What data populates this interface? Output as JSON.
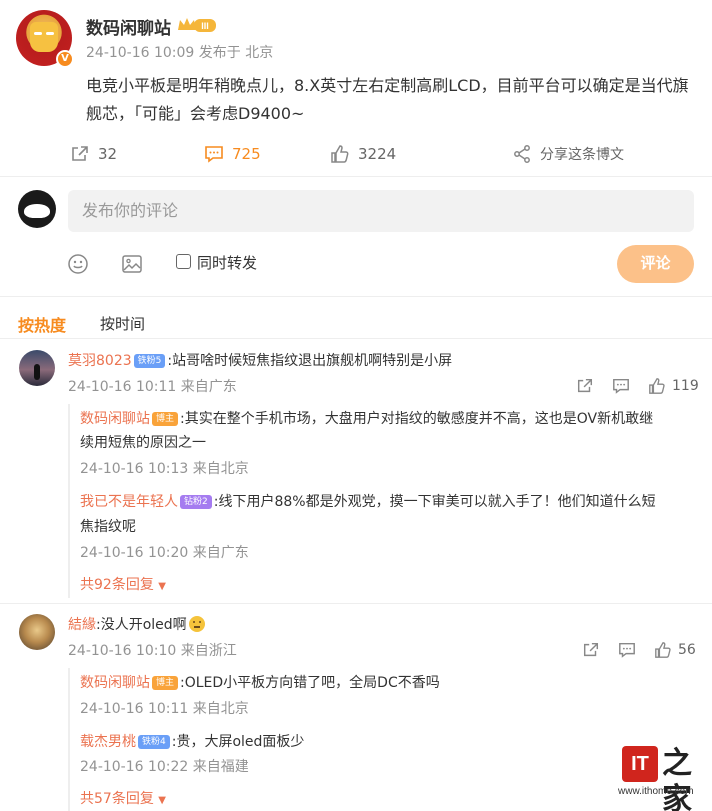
{
  "post": {
    "author": "数码闲聊站",
    "level_badge": "III",
    "meta": "24-10-16 10:09 发布于 北京",
    "verified_mark": "V",
    "body": "电竞小平板是明年稍晚点儿，8.X英寸左右定制高刷LCD，目前平台可以确定是当代旗舰芯，「可能」会考虑D9400~",
    "actions": {
      "repost": "32",
      "comments": "725",
      "likes": "3224",
      "share": "分享这条博文"
    }
  },
  "composer": {
    "placeholder": "发布你的评论",
    "repost_label": "同时转发",
    "submit_label": "评论"
  },
  "sort": {
    "hot": "按热度",
    "time": "按时间"
  },
  "comments": [
    {
      "name": "莫羽8023",
      "badge": "铁粉5",
      "text": ":站哥啥时候短焦指纹退出旗舰机啊特别是小屏",
      "meta": "24-10-16 10:11 来自广东",
      "likes": "119",
      "replies": [
        {
          "name": "数码闲聊站",
          "badge": "博主",
          "text_line1": ":其实在整个手机市场，大盘用户对指纹的敏感度并不高，这也是OV新机敢继",
          "text_line2": "续用短焦的原因之一",
          "meta": "24-10-16 10:13 来自北京"
        },
        {
          "name": "我已不是年轻人",
          "badge": "钻粉2",
          "text_line1": ":线下用户88%都是外观党，摸一下审美可以就入手了！他们知道什么短",
          "text_line2": "焦指纹呢",
          "meta": "24-10-16 10:20 来自广东"
        }
      ],
      "more": "共92条回复"
    },
    {
      "name": "結緣",
      "text": ":没人开oled啊",
      "meta": "24-10-16 10:10 来自浙江",
      "likes": "56",
      "replies": [
        {
          "name": "数码闲聊站",
          "badge": "博主",
          "text_line1": ":OLED小平板方向错了吧，全局DC不香吗",
          "meta": "24-10-16 10:11 来自北京"
        },
        {
          "name": "载杰男桃",
          "badge": "铁粉4",
          "text_line1": ":贵，大屏oled面板少",
          "meta": "24-10-16 10:22 来自福建"
        }
      ],
      "more": "共57条回复"
    }
  ],
  "watermark": {
    "logo": "IT",
    "char": "之家",
    "url": "www.ithome.com"
  },
  "colors": {
    "accent": "#f78b1f",
    "name": "#eb7350",
    "meta": "#939393"
  }
}
